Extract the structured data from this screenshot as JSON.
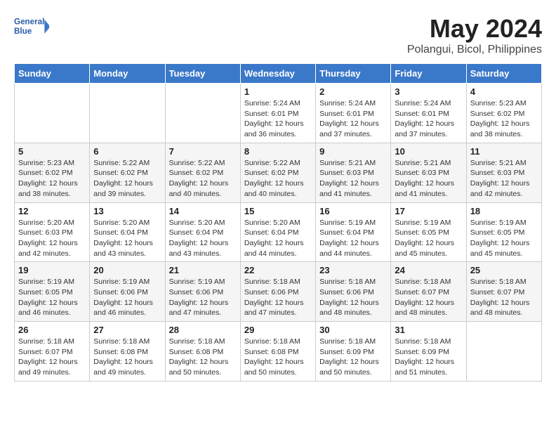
{
  "logo": {
    "line1": "General",
    "line2": "Blue"
  },
  "title": "May 2024",
  "location": "Polangui, Bicol, Philippines",
  "days_of_week": [
    "Sunday",
    "Monday",
    "Tuesday",
    "Wednesday",
    "Thursday",
    "Friday",
    "Saturday"
  ],
  "weeks": [
    [
      {
        "day": "",
        "info": ""
      },
      {
        "day": "",
        "info": ""
      },
      {
        "day": "",
        "info": ""
      },
      {
        "day": "1",
        "info": "Sunrise: 5:24 AM\nSunset: 6:01 PM\nDaylight: 12 hours\nand 36 minutes."
      },
      {
        "day": "2",
        "info": "Sunrise: 5:24 AM\nSunset: 6:01 PM\nDaylight: 12 hours\nand 37 minutes."
      },
      {
        "day": "3",
        "info": "Sunrise: 5:24 AM\nSunset: 6:01 PM\nDaylight: 12 hours\nand 37 minutes."
      },
      {
        "day": "4",
        "info": "Sunrise: 5:23 AM\nSunset: 6:02 PM\nDaylight: 12 hours\nand 38 minutes."
      }
    ],
    [
      {
        "day": "5",
        "info": "Sunrise: 5:23 AM\nSunset: 6:02 PM\nDaylight: 12 hours\nand 38 minutes."
      },
      {
        "day": "6",
        "info": "Sunrise: 5:22 AM\nSunset: 6:02 PM\nDaylight: 12 hours\nand 39 minutes."
      },
      {
        "day": "7",
        "info": "Sunrise: 5:22 AM\nSunset: 6:02 PM\nDaylight: 12 hours\nand 40 minutes."
      },
      {
        "day": "8",
        "info": "Sunrise: 5:22 AM\nSunset: 6:02 PM\nDaylight: 12 hours\nand 40 minutes."
      },
      {
        "day": "9",
        "info": "Sunrise: 5:21 AM\nSunset: 6:03 PM\nDaylight: 12 hours\nand 41 minutes."
      },
      {
        "day": "10",
        "info": "Sunrise: 5:21 AM\nSunset: 6:03 PM\nDaylight: 12 hours\nand 41 minutes."
      },
      {
        "day": "11",
        "info": "Sunrise: 5:21 AM\nSunset: 6:03 PM\nDaylight: 12 hours\nand 42 minutes."
      }
    ],
    [
      {
        "day": "12",
        "info": "Sunrise: 5:20 AM\nSunset: 6:03 PM\nDaylight: 12 hours\nand 42 minutes."
      },
      {
        "day": "13",
        "info": "Sunrise: 5:20 AM\nSunset: 6:04 PM\nDaylight: 12 hours\nand 43 minutes."
      },
      {
        "day": "14",
        "info": "Sunrise: 5:20 AM\nSunset: 6:04 PM\nDaylight: 12 hours\nand 43 minutes."
      },
      {
        "day": "15",
        "info": "Sunrise: 5:20 AM\nSunset: 6:04 PM\nDaylight: 12 hours\nand 44 minutes."
      },
      {
        "day": "16",
        "info": "Sunrise: 5:19 AM\nSunset: 6:04 PM\nDaylight: 12 hours\nand 44 minutes."
      },
      {
        "day": "17",
        "info": "Sunrise: 5:19 AM\nSunset: 6:05 PM\nDaylight: 12 hours\nand 45 minutes."
      },
      {
        "day": "18",
        "info": "Sunrise: 5:19 AM\nSunset: 6:05 PM\nDaylight: 12 hours\nand 45 minutes."
      }
    ],
    [
      {
        "day": "19",
        "info": "Sunrise: 5:19 AM\nSunset: 6:05 PM\nDaylight: 12 hours\nand 46 minutes."
      },
      {
        "day": "20",
        "info": "Sunrise: 5:19 AM\nSunset: 6:06 PM\nDaylight: 12 hours\nand 46 minutes."
      },
      {
        "day": "21",
        "info": "Sunrise: 5:19 AM\nSunset: 6:06 PM\nDaylight: 12 hours\nand 47 minutes."
      },
      {
        "day": "22",
        "info": "Sunrise: 5:18 AM\nSunset: 6:06 PM\nDaylight: 12 hours\nand 47 minutes."
      },
      {
        "day": "23",
        "info": "Sunrise: 5:18 AM\nSunset: 6:06 PM\nDaylight: 12 hours\nand 48 minutes."
      },
      {
        "day": "24",
        "info": "Sunrise: 5:18 AM\nSunset: 6:07 PM\nDaylight: 12 hours\nand 48 minutes."
      },
      {
        "day": "25",
        "info": "Sunrise: 5:18 AM\nSunset: 6:07 PM\nDaylight: 12 hours\nand 48 minutes."
      }
    ],
    [
      {
        "day": "26",
        "info": "Sunrise: 5:18 AM\nSunset: 6:07 PM\nDaylight: 12 hours\nand 49 minutes."
      },
      {
        "day": "27",
        "info": "Sunrise: 5:18 AM\nSunset: 6:08 PM\nDaylight: 12 hours\nand 49 minutes."
      },
      {
        "day": "28",
        "info": "Sunrise: 5:18 AM\nSunset: 6:08 PM\nDaylight: 12 hours\nand 50 minutes."
      },
      {
        "day": "29",
        "info": "Sunrise: 5:18 AM\nSunset: 6:08 PM\nDaylight: 12 hours\nand 50 minutes."
      },
      {
        "day": "30",
        "info": "Sunrise: 5:18 AM\nSunset: 6:09 PM\nDaylight: 12 hours\nand 50 minutes."
      },
      {
        "day": "31",
        "info": "Sunrise: 5:18 AM\nSunset: 6:09 PM\nDaylight: 12 hours\nand 51 minutes."
      },
      {
        "day": "",
        "info": ""
      }
    ]
  ]
}
